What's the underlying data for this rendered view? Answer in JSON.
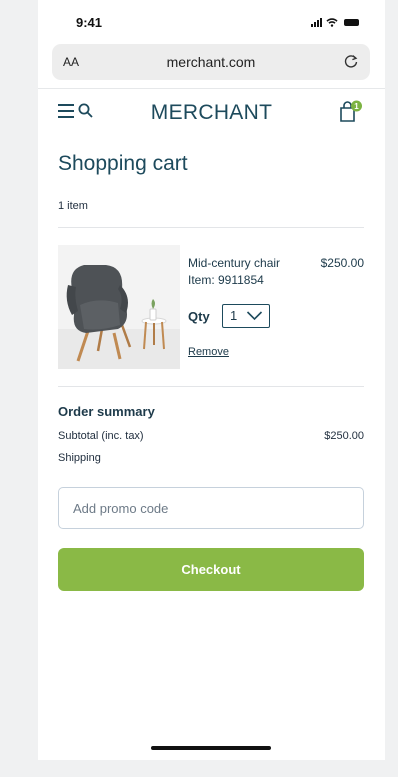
{
  "status_bar": {
    "time": "9:41"
  },
  "browser": {
    "text_size_label": "AA",
    "url": "merchant.com"
  },
  "header": {
    "brand": "MERCHANT",
    "cart_count": "1"
  },
  "page": {
    "title": "Shopping cart",
    "items_count": "1 item"
  },
  "cart_items": [
    {
      "name": "Mid-century chair",
      "price": "$250.00",
      "sku": "Item: 9911854",
      "qty_label": "Qty",
      "qty": "1",
      "remove_label": "Remove"
    }
  ],
  "summary": {
    "title": "Order summary",
    "subtotal_label": "Subtotal (inc. tax)",
    "subtotal_value": "$250.00",
    "shipping_label": "Shipping"
  },
  "promo": {
    "placeholder": "Add promo code"
  },
  "checkout": {
    "label": "Checkout"
  },
  "colors": {
    "brand": "#1d4a5c",
    "accent": "#8ab946",
    "badge": "#7cb342"
  },
  "icons": [
    "hamburger-icon",
    "search-icon",
    "cart-icon",
    "reload-icon",
    "chevron-down-icon",
    "signal-icon",
    "wifi-icon",
    "battery-icon"
  ]
}
